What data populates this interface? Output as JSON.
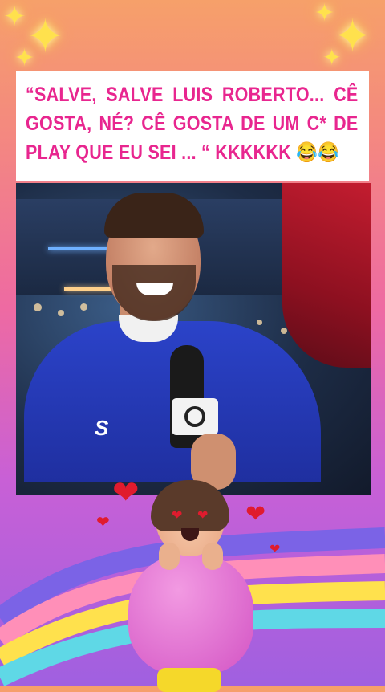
{
  "caption": {
    "text": "“SALVE, SALVE LUIS ROBERTO... CÊ GOSTA, NÉ? CÊ GOSTA DE UM C* DE PLAY QUE EU SEI ... “ KKKKKK 😂😂"
  },
  "photo": {
    "shirt_logo": "S"
  },
  "decor": {
    "sparkle_icon": "sparkle-icon",
    "heart_icon": "heart-icon",
    "colors": {
      "caption_text": "#e8268f",
      "shirt": "#2b43c9",
      "sparkle": "#ffe14d",
      "heart": "#e01b2e"
    }
  }
}
